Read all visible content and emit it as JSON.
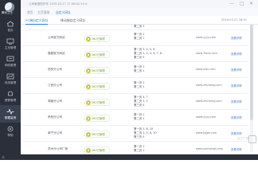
{
  "app": {
    "name": "腾讯卫士",
    "title_bar": "公司家庭防护手 2019.03.27 17:36:01 V1.0"
  },
  "window_controls": {
    "minimize": "—",
    "maximize": "□",
    "close": "✕"
  },
  "breadcrumb": {
    "home": "首页",
    "section": "主页管理",
    "current": "自定义网址"
  },
  "tabs": [
    {
      "label": "PC端自定义网址"
    },
    {
      "label": "移动端自定义网址"
    }
  ],
  "timestamp": "2019.03.27 16:51",
  "sidebar": {
    "items": [
      {
        "label": "首页",
        "icon": "home-icon"
      },
      {
        "label": "主页管理",
        "icon": "monitor-icon"
      },
      {
        "label": "网络管理",
        "icon": "network-icon"
      },
      {
        "label": "系统管理",
        "icon": "chart-icon"
      },
      {
        "label": "报警管理",
        "icon": "bell-icon"
      },
      {
        "label": "数据监测",
        "icon": "pulse-icon"
      },
      {
        "label": "帮助",
        "icon": "gear-icon"
      }
    ]
  },
  "table": {
    "rows": [
      {
        "site": "",
        "badge": "",
        "order": [
          "第二页 1"
        ],
        "url": "",
        "detail": ""
      },
      {
        "site": "公司官方网站",
        "badge": "360已管理",
        "order": [
          "第一页 1",
          "第二页 1"
        ],
        "url": "www.yyyy.com",
        "detail": "查看详情"
      },
      {
        "site": "旗舰官方网站",
        "badge": "360已管理",
        "order": [
          "第一页 3, 4, 5, 6",
          "第二页 1, 2, 3, 4, 7, 8",
          "第三页 5"
        ],
        "url": "www.7fans.com",
        "detail": "查看详情"
      },
      {
        "site": "西安分公司",
        "badge": "360已管理",
        "order": [
          "第一页 1",
          "第二页 1"
        ],
        "url": "www.xian.com",
        "detail": "查看详情"
      },
      {
        "site": "江西分公司",
        "badge": "360已管理",
        "order": [
          "第一页 1",
          "第二页 1"
        ],
        "url": "www.zhichang.com",
        "detail": "查看详情"
      },
      {
        "site": "湖南分公司",
        "badge": "360已管理",
        "order": [
          "第一页 4, 7",
          "第二页 1, 2",
          "第三页 4"
        ],
        "url": "www.zhichang.com",
        "detail": "查看详情"
      },
      {
        "site": "贵阳分公司",
        "badge": "360已管理",
        "order": [
          "第一页 1",
          "第二页 1"
        ],
        "url": "www.yyyy.com",
        "detail": "查看详情"
      },
      {
        "site": "南宁分公司",
        "badge": "360已管理",
        "order": [
          "第一页 1, 8, 10",
          "第二页 1, 2, 8, 10",
          "第三页 5"
        ],
        "url": "www.jxjjgs.com",
        "detail": "查看详情"
      },
      {
        "site": "苏州分公司厂家",
        "badge": "360已管理",
        "order": [
          "第一页 1",
          "第二页 1"
        ],
        "url": "www.yonhengli.com",
        "detail": "查看详情"
      }
    ]
  },
  "bottom": {
    "left": "人",
    "watermark": "官方下载"
  },
  "colors": {
    "sidebar_bg": "#2a2f3a",
    "accent": "#2e7bdc",
    "badge_text": "#6aaa20"
  }
}
